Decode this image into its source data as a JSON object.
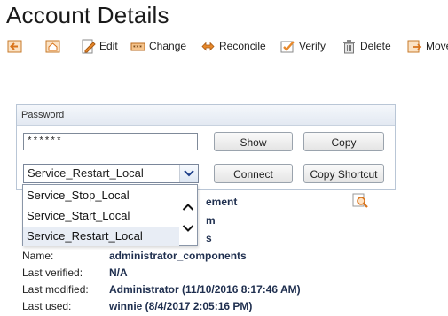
{
  "page": {
    "title": "Account Details"
  },
  "toolbar": {
    "items": [
      {
        "label": "",
        "icon": "back-arrow-icon"
      },
      {
        "label": "",
        "icon": "home-icon"
      },
      {
        "label": "Edit",
        "icon": "edit-icon"
      },
      {
        "label": "Change",
        "icon": "change-icon"
      },
      {
        "label": "Reconcile",
        "icon": "reconcile-icon"
      },
      {
        "label": "Verify",
        "icon": "verify-icon"
      },
      {
        "label": "Delete",
        "icon": "trash-icon"
      },
      {
        "label": "Move",
        "icon": "move-icon"
      }
    ]
  },
  "password_panel": {
    "header": "Password",
    "password_value": "******",
    "show_label": "Show",
    "copy_label": "Copy",
    "connect_label": "Connect",
    "copy_shortcut_label": "Copy Shortcut",
    "selected_option": "Service_Restart_Local",
    "options": [
      "Service_Stop_Local",
      "Service_Start_Local",
      "Service_Restart_Local"
    ]
  },
  "details": {
    "partial_values": [
      "ement",
      "m",
      "s"
    ],
    "rows": [
      {
        "label": "Name:",
        "value": "administrator_components"
      },
      {
        "label": "Last verified:",
        "value": "N/A"
      },
      {
        "label": "Last modified:",
        "value": "Administrator (11/10/2016 8:17:46 AM)"
      },
      {
        "label": "Last used:",
        "value": "winnie (8/4/2017 2:05:16 PM)"
      }
    ]
  },
  "colors": {
    "accent_orange": "#e8892b",
    "text_dark_blue": "#1f2f4f",
    "panel_border": "#b9c6d6"
  }
}
